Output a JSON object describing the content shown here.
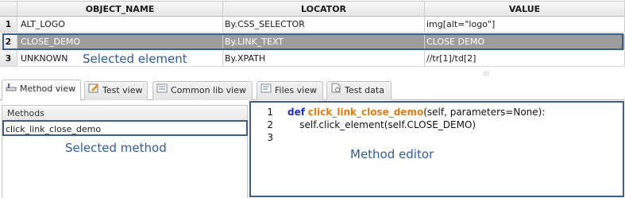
{
  "table": {
    "columns": [
      "OBJECT_NAME",
      "LOCATOR",
      "VALUE"
    ],
    "rows": [
      {
        "num": "1",
        "name": "ALT_LOGO",
        "locator": "By.CSS_SELECTOR",
        "value": "img[alt=\"logo\"]"
      },
      {
        "num": "2",
        "name": "CLOSE_DEMO",
        "locator": "By.LINK_TEXT",
        "value": "CLOSE DEMO"
      },
      {
        "num": "3",
        "name": "UNKNOWN",
        "locator": "By.XPATH",
        "value": "//tr[1]/td[2]"
      }
    ]
  },
  "annotations": {
    "selected_element": "Selected element",
    "selected_method": "Selected method",
    "method_editor": "Method editor"
  },
  "tabs": [
    {
      "label": "Method view",
      "icon": "method-view-icon",
      "active": true
    },
    {
      "label": "Test view",
      "icon": "test-view-icon",
      "active": false
    },
    {
      "label": "Common lib view",
      "icon": "common-lib-icon",
      "active": false
    },
    {
      "label": "Files view",
      "icon": "files-view-icon",
      "active": false
    },
    {
      "label": "Test data",
      "icon": "test-data-icon",
      "active": false
    }
  ],
  "methods": {
    "header": "Methods",
    "items": [
      "click_link_close_demo"
    ]
  },
  "editor": {
    "line_numbers": [
      "1",
      "2",
      "3"
    ],
    "line1": {
      "keyword": "def",
      "function": "click_link_close_demo",
      "rest": "(self, parameters=None):"
    },
    "line2": "    self.click_element(self.CLOSE_DEMO)",
    "line3": ""
  },
  "colors": {
    "selection_row": "#9d9d9d",
    "highlight_border": "#3a5f93",
    "annotation_text": "#2f5aa8",
    "keyword": "#1e2bd0",
    "function_name": "#ea7a10"
  }
}
